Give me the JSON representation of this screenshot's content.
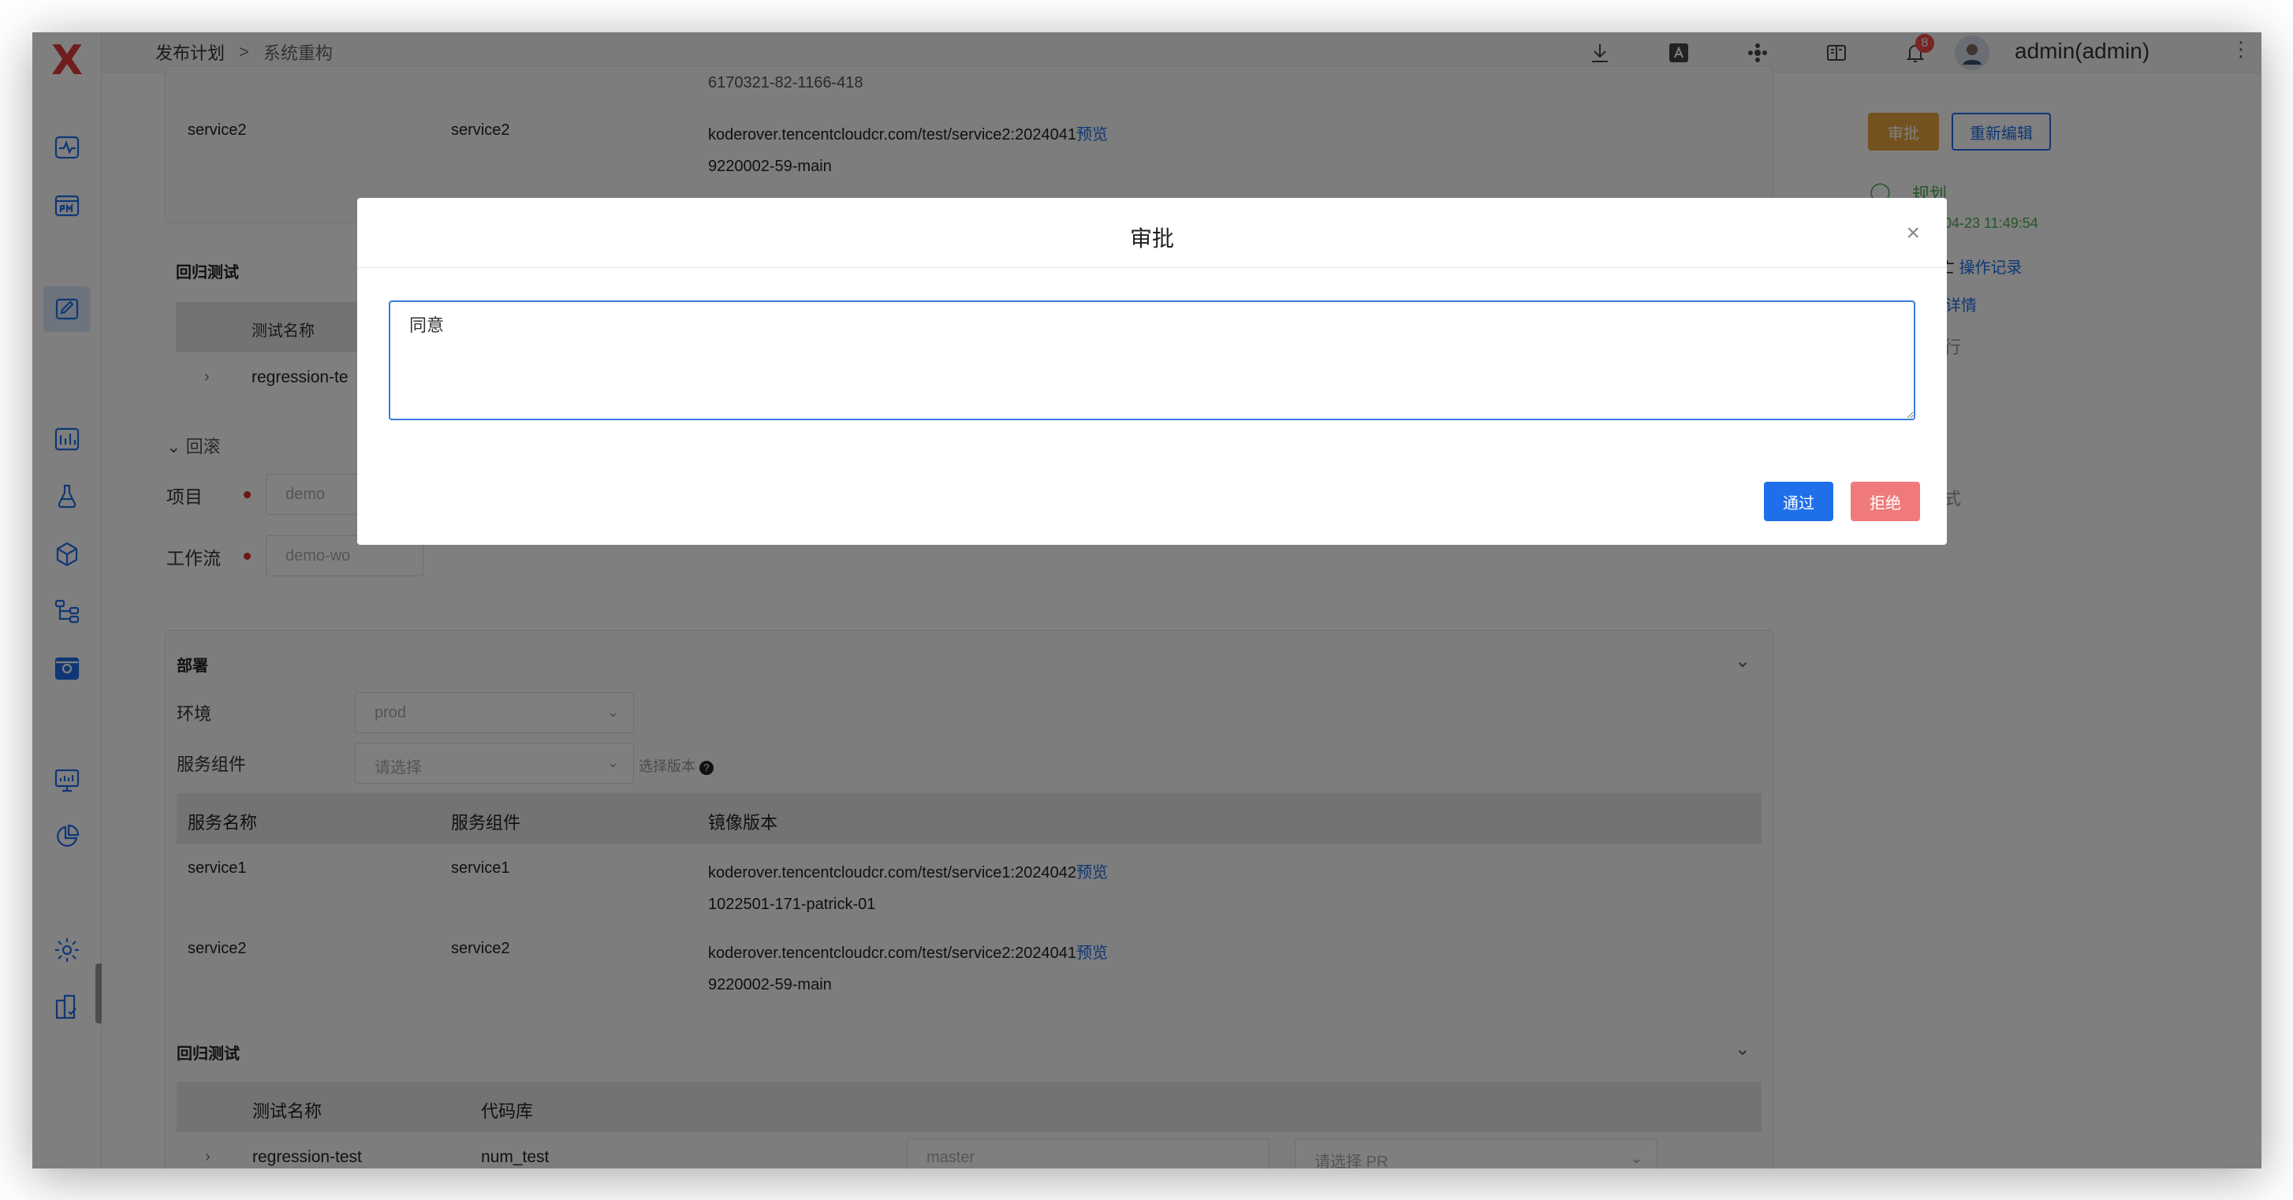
{
  "app": {
    "logo_symbol": "X"
  },
  "breadcrumb": {
    "parent": "发布计划",
    "separator": ">",
    "current": "系统重构"
  },
  "topbar": {
    "notification_count": "8",
    "user": "admin(admin)",
    "more": "⋮"
  },
  "top_fragment": {
    "cut_text": "6170321-82-1166-418",
    "row_service": "service2",
    "row_component": "service2",
    "row_image": "koderover.tencentcloudcr.com/test/service2:2024041",
    "row_image_cont": "9220002-59-main",
    "preview": "预览",
    "regression_title": "回归测试",
    "test_name_header": "测试名称",
    "test_row": "regression-te"
  },
  "rollback": {
    "toggle": "回滚",
    "project_label": "项目",
    "project_value": "demo",
    "workflow_label": "工作流",
    "workflow_value": "demo-wo"
  },
  "right_panel": {
    "approve_btn": "审批",
    "reedit_btn": "重新编辑",
    "status": "规划",
    "time": "-04-23 11:49:54",
    "log_link": "操作记录",
    "detail_link": "详情",
    "fragment_a": "亡",
    "fragment_b": "行",
    "fragment_c": "式"
  },
  "deploy": {
    "title": "部署",
    "env_label": "环境",
    "env_value": "prod",
    "component_label": "服务组件",
    "component_placeholder": "请选择",
    "version_hint": "选择版本",
    "headers": [
      "服务名称",
      "服务组件",
      "镜像版本"
    ],
    "rows": [
      {
        "service": "service1",
        "component": "service1",
        "image": "koderover.tencentcloudcr.com/test/service1:2024042",
        "image_cont": "1022501-171-patrick-01",
        "preview": "预览"
      },
      {
        "service": "service2",
        "component": "service2",
        "image": "koderover.tencentcloudcr.com/test/service2:2024041",
        "image_cont": "9220002-59-main",
        "preview": "预览"
      }
    ]
  },
  "regression": {
    "title": "回归测试",
    "headers": [
      "测试名称",
      "代码库"
    ],
    "row": {
      "name": "regression-test",
      "repo": "num_test",
      "branch": "master",
      "pr_placeholder": "请选择 PR"
    }
  },
  "modal": {
    "title": "审批",
    "textarea_value": "同意",
    "approve": "通过",
    "reject": "拒绝"
  },
  "colors": {
    "accent": "#1f6feb",
    "approve": "#1f6feb",
    "reject": "#f07a7a",
    "approve_tag": "#e8a33d",
    "status_green": "#4caf50"
  }
}
